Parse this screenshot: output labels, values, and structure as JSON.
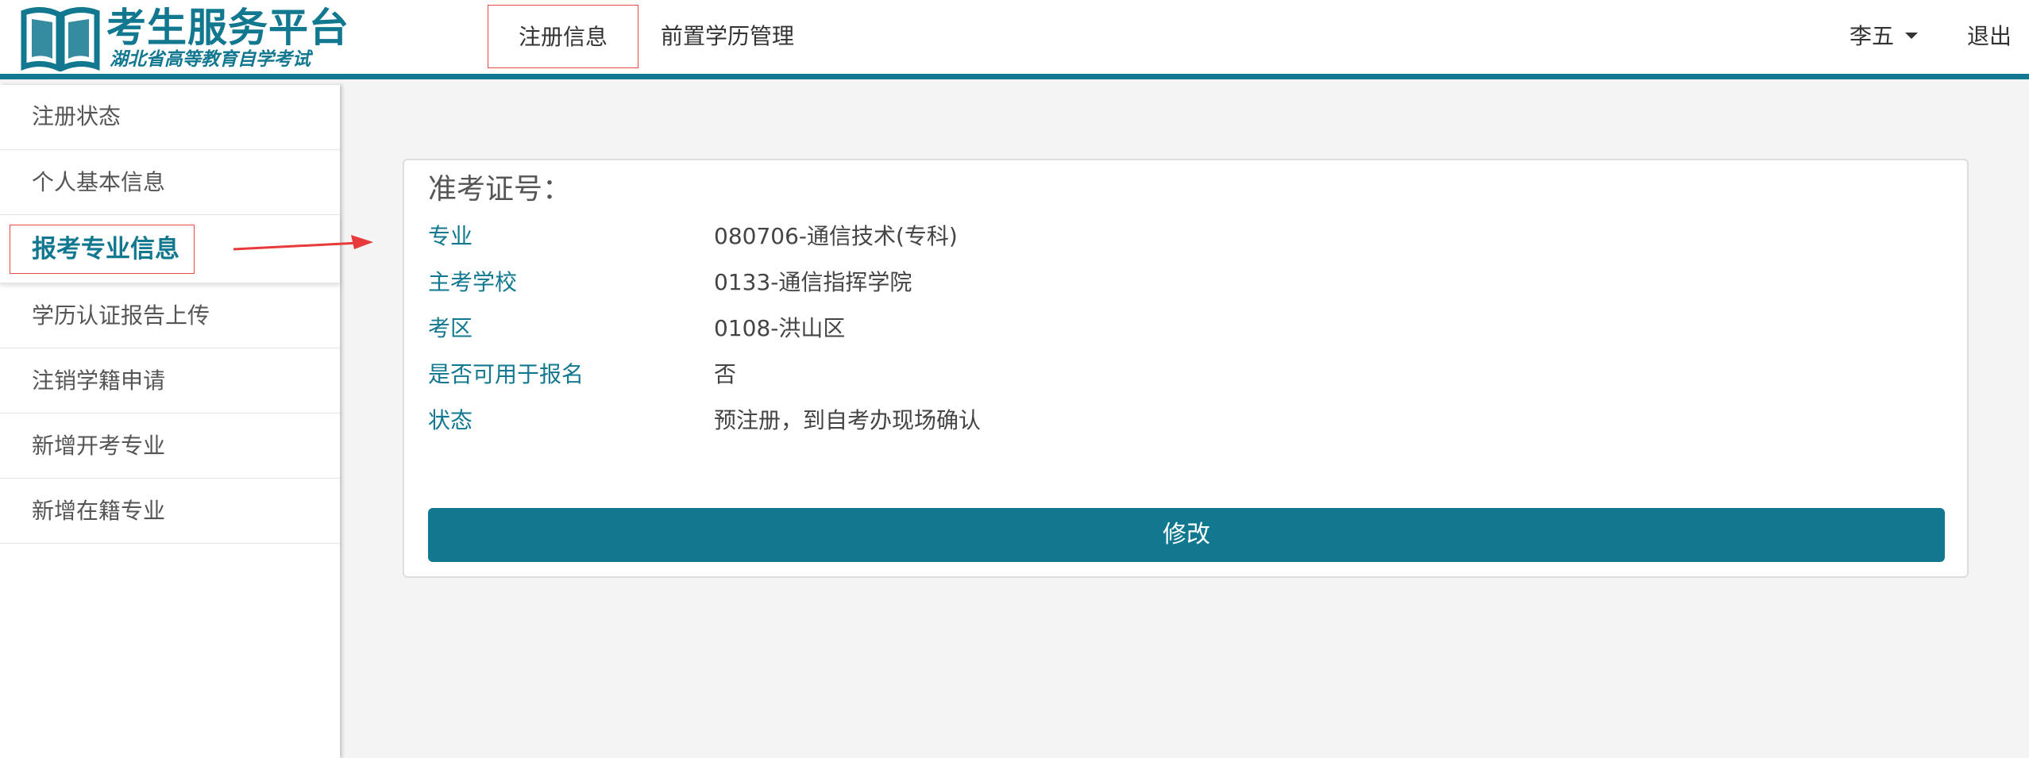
{
  "header": {
    "logo_title": "考生服务平台",
    "logo_subtitle": "湖北省高等教育自学考试",
    "nav_tabs": [
      {
        "label": "注册信息",
        "active": true
      },
      {
        "label": "前置学历管理",
        "active": false
      }
    ],
    "user_name": "李五",
    "logout_label": "退出"
  },
  "sidebar": {
    "items": [
      {
        "label": "注册状态"
      },
      {
        "label": "个人基本信息"
      },
      {
        "label": "报考专业信息",
        "active": true
      },
      {
        "label": "学历认证报告上传"
      },
      {
        "label": "注销学籍申请"
      },
      {
        "label": "新增开考专业"
      },
      {
        "label": "新增在籍专业"
      }
    ]
  },
  "panel": {
    "title": "准考证号：",
    "rows": [
      {
        "label": "专业",
        "value": "080706-通信技术(专科)"
      },
      {
        "label": "主考学校",
        "value": "0133-通信指挥学院"
      },
      {
        "label": "考区",
        "value": "0108-洪山区"
      },
      {
        "label": "是否可用于报名",
        "value": "否"
      },
      {
        "label": "状态",
        "value": "预注册，到自考办现场确认"
      }
    ],
    "edit_label": "修改"
  },
  "colors": {
    "accent": "#127890",
    "highlight_border": "#e84a4a",
    "arrow": "#e83a3a",
    "background": "#f4f4f4"
  },
  "icons": {
    "logo": "open-book-icon",
    "user_menu": "caret-down-icon",
    "annotation": "red-arrow-icon"
  }
}
